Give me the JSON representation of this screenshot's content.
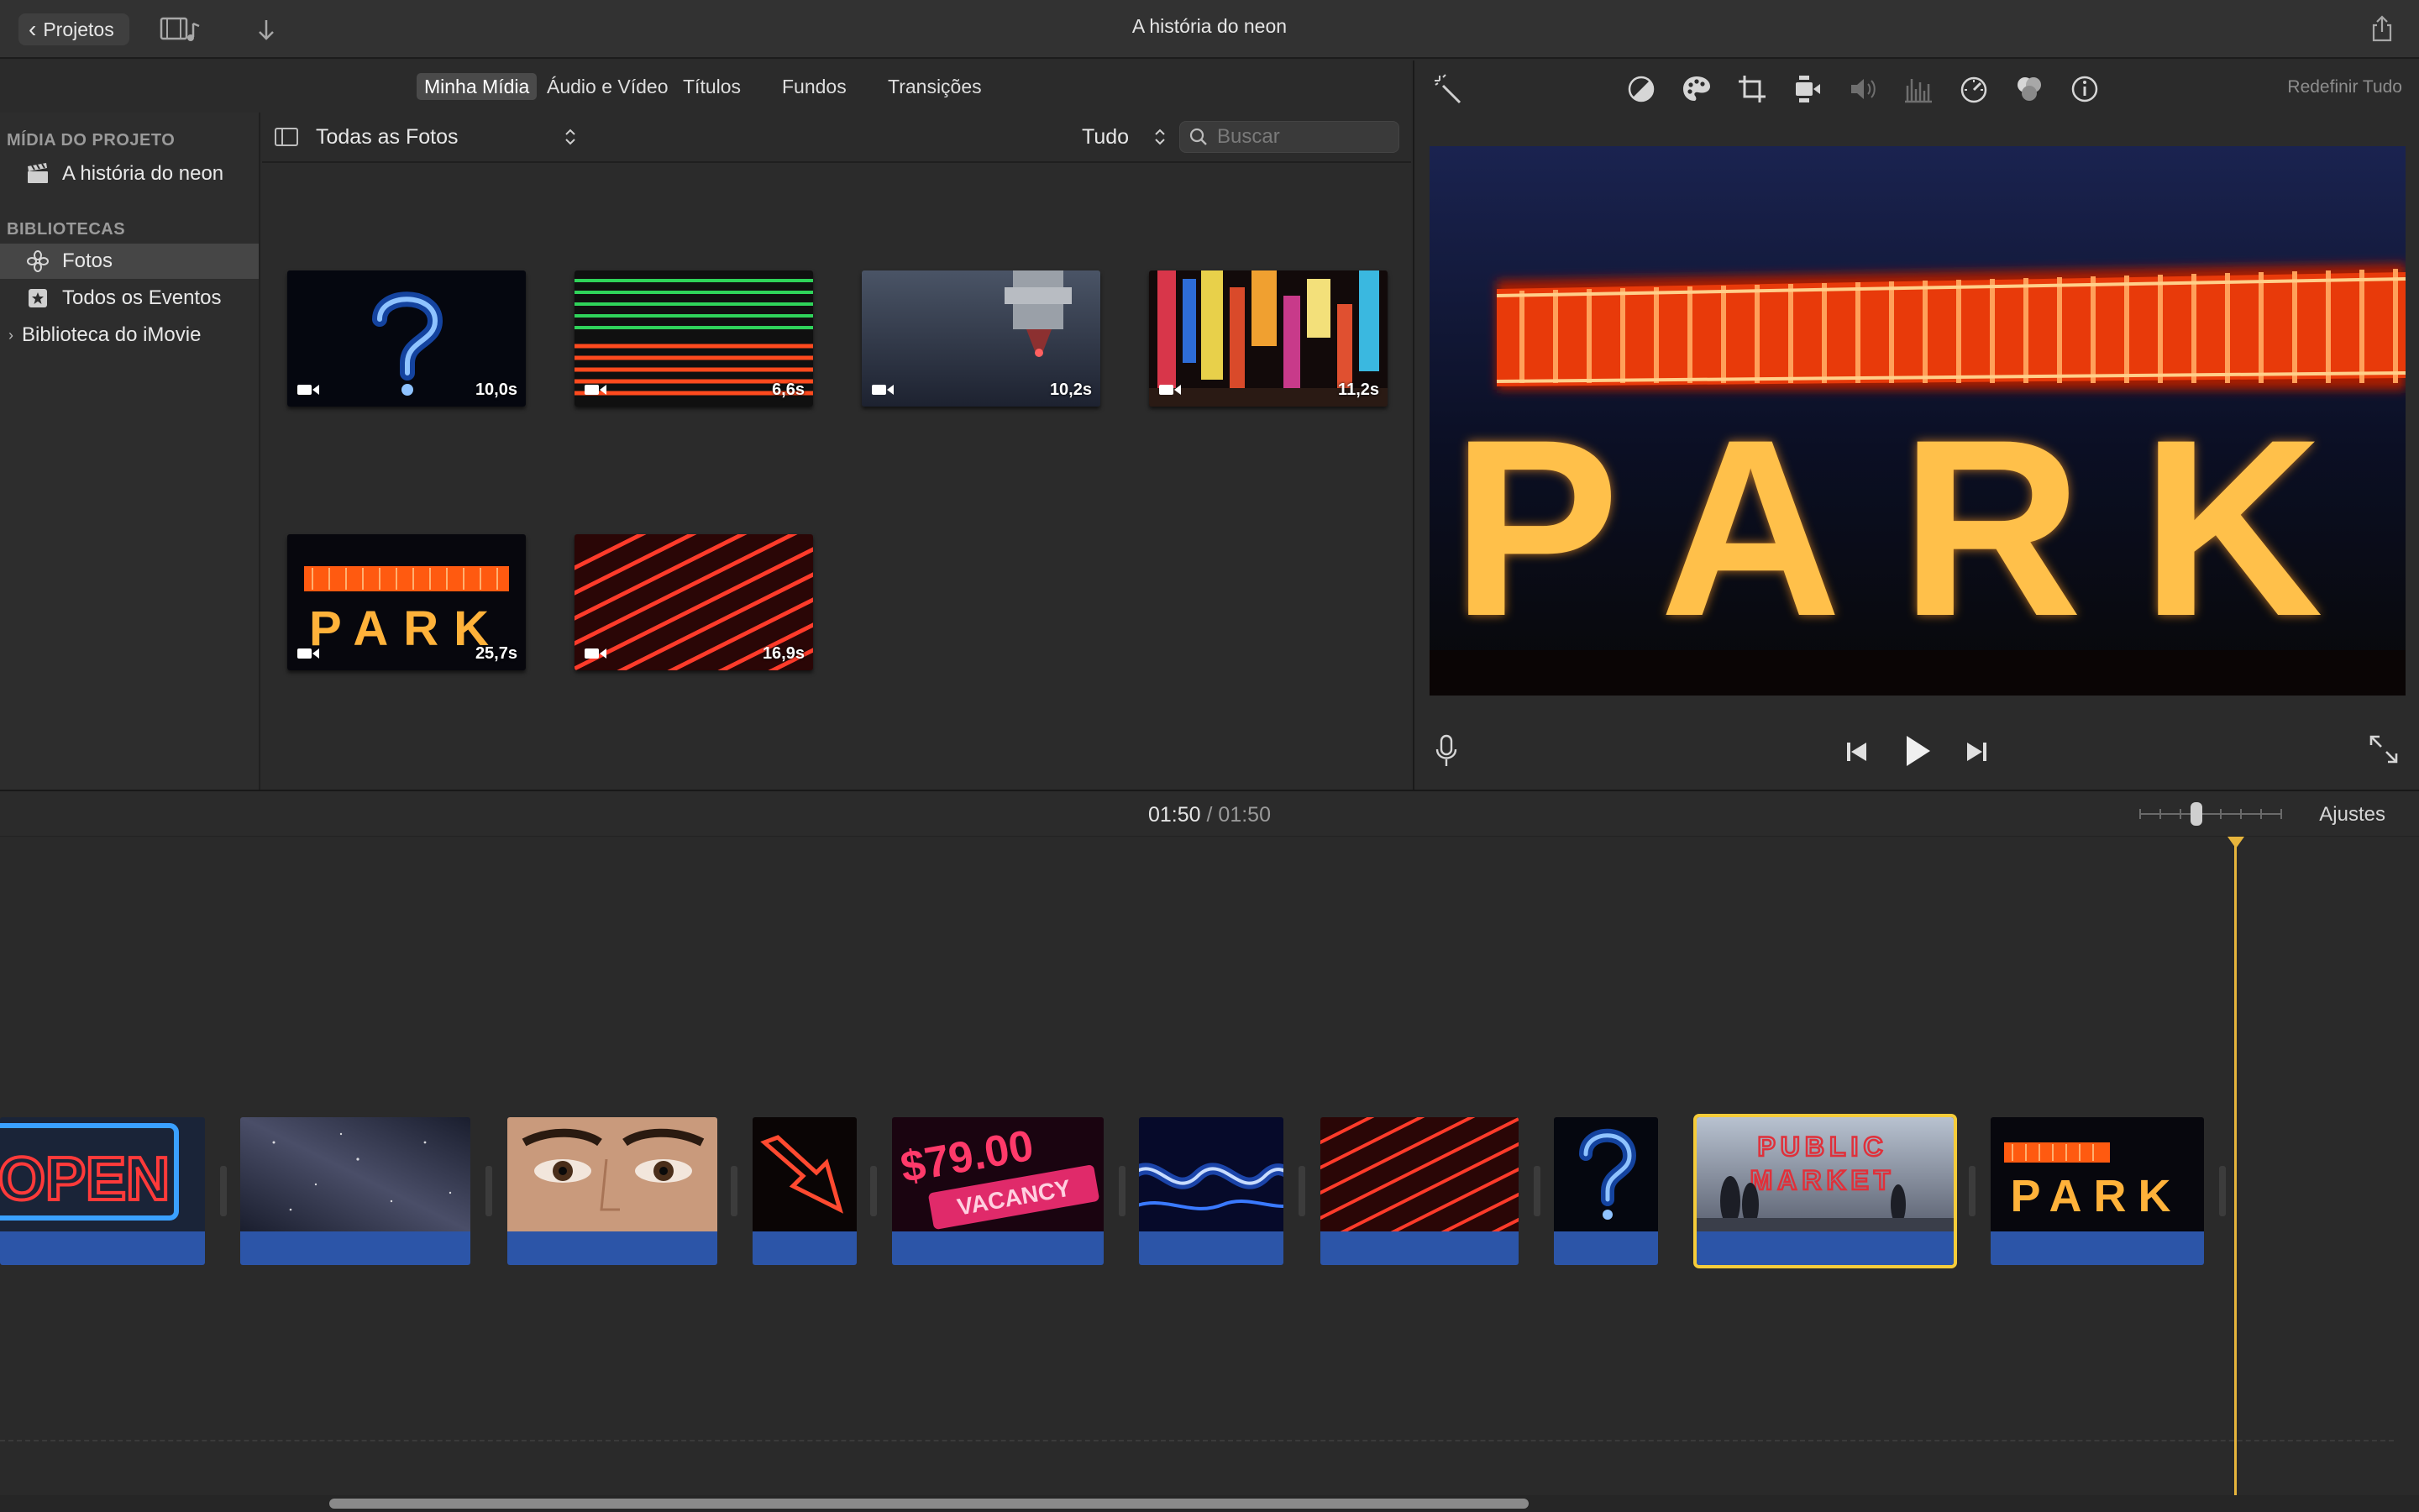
{
  "window": {
    "title": "A história do neon"
  },
  "toolbar": {
    "back_label": "Projetos"
  },
  "browser": {
    "tabs": [
      {
        "label": "Minha Mídia"
      },
      {
        "label": "Áudio e Vídeo"
      },
      {
        "label": "Títulos"
      },
      {
        "label": "Fundos"
      },
      {
        "label": "Transições"
      }
    ],
    "sidebar": {
      "project_header": "MÍDIA DO PROJETO",
      "project_item": "A história do neon",
      "libraries_header": "BIBLIOTECAS",
      "photos": "Fotos",
      "all_events": "Todos os Eventos",
      "library": "Biblioteca do iMovie"
    },
    "filter": {
      "source": "Todas as Fotos",
      "scope": "Tudo",
      "search_placeholder": "Buscar"
    },
    "clips": [
      {
        "duration": "10,0s",
        "subject": "question-mark-neon"
      },
      {
        "duration": "6,6s",
        "subject": "green-red-neon-lines"
      },
      {
        "duration": "10,2s",
        "subject": "machine-closeup"
      },
      {
        "duration": "11,2s",
        "subject": "city-neon-signs"
      },
      {
        "duration": "25,7s",
        "subject": "park-sign"
      },
      {
        "duration": "16,9s",
        "subject": "red-diagonal-neon"
      }
    ]
  },
  "viewer": {
    "reset_label": "Redefinir Tudo",
    "preview_text": "PARK"
  },
  "timeline": {
    "current_time": "01:50",
    "separator": "/",
    "total_time": "01:50",
    "settings_label": "Ajustes",
    "clip_texts": {
      "open": "OPEN",
      "price": "$79.00",
      "vacancy": "VACANCY",
      "public": "PUBLIC",
      "market": "MARKET",
      "park": "PARK"
    }
  },
  "colors": {
    "accent_playhead": "#e7b53c",
    "audio_track": "#2c55a8",
    "selection": "#f6cc3a"
  }
}
